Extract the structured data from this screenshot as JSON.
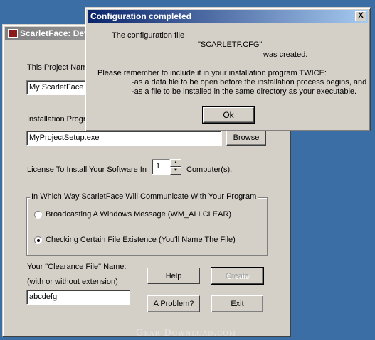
{
  "main_window": {
    "title": "ScarletFace: Dev",
    "project_name_label": "This Project Nam",
    "project_name_value": "My ScarletFace",
    "installation_label": "Installation Progra",
    "installation_value": "MyProjectSetup.exe",
    "browse_label": "Browse",
    "license_label": "License To Install Your Software In",
    "license_count": "1",
    "computers_label": "Computer(s).",
    "group_title": "In Which Way ScarletFace Will Communicate With Your Program",
    "radio_broadcast_label": "Broadcasting A Windows Message (WM_ALLCLEAR)",
    "radio_file_label": "Checking Certain File Existence (You'll Name The File)",
    "selected_radio": "file",
    "clearance_label": "Your \"Clearance File\" Name:",
    "extension_hint": "(with or without extension)",
    "clearance_value": "abcdefg",
    "help_label": "Help",
    "create_label": "Create",
    "problem_label": "A Problem?",
    "exit_label": "Exit"
  },
  "dialog": {
    "title": "Configuration completed",
    "close_glyph": "X",
    "line1": "The configuration file",
    "filename": "\"SCARLETF.CFG\"",
    "line3": "was created.",
    "line4": "Please remember to include it in your installation program TWICE:",
    "line5": "-as a data file to be open before the installation process begins, and",
    "line6": "-as a file to be installed in the same directory as your executable.",
    "ok_label": "Ok"
  },
  "watermark": "Gear Download.com",
  "colors": {
    "desktop": "#3a6ea5",
    "face": "#d4d0c8",
    "active_title": "#0a246a",
    "inactive_title": "#808080"
  }
}
